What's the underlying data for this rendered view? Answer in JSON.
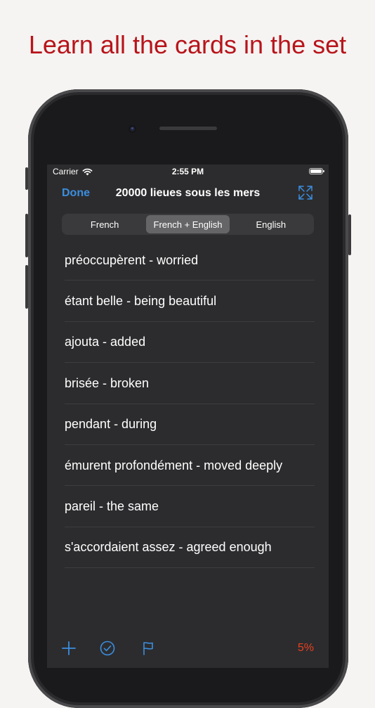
{
  "headline": "Learn all the cards in the set",
  "status_bar": {
    "carrier": "Carrier",
    "time": "2:55 PM",
    "wifi_icon": "wifi-icon",
    "battery_icon": "battery-icon"
  },
  "nav": {
    "done_label": "Done",
    "title": "20000 lieues sous les mers",
    "expand_icon": "expand-icon"
  },
  "segments": {
    "items": [
      "French",
      "French + English",
      "English"
    ],
    "selected": "French + English"
  },
  "cards": [
    "préoccupèrent - worried",
    "étant belle - being beautiful",
    "ajouta - added",
    "brisée - broken",
    "pendant - during",
    "émurent profondément - moved deeply",
    "pareil - the same",
    "s'accordaient assez - agreed enough"
  ],
  "toolbar": {
    "add_icon": "plus-icon",
    "check_icon": "checkmark-circle-icon",
    "flag_icon": "flag-icon",
    "progress": "5%"
  },
  "colors": {
    "headline": "#b8141b",
    "accent": "#3b8ee0",
    "progress": "#e8401f",
    "screen_bg": "#2c2c2e"
  }
}
